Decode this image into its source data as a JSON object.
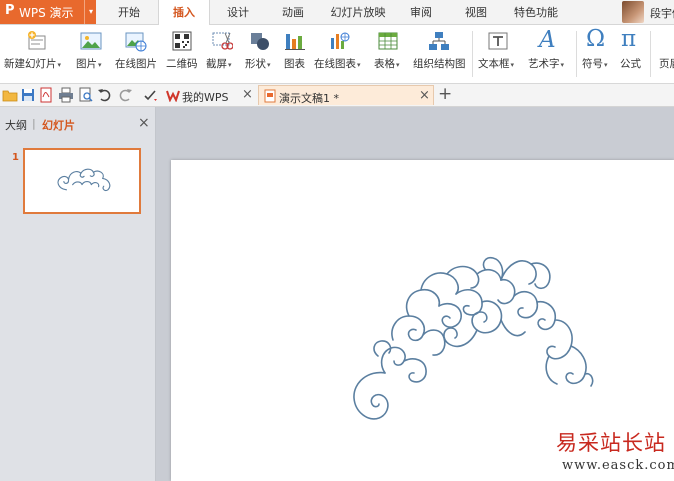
{
  "app": {
    "logo_glyph": "P",
    "title": "WPS 演示",
    "menu_arrow": "▾",
    "accent_color": "#e8692d"
  },
  "menu": {
    "tabs": [
      {
        "label": "开始"
      },
      {
        "label": "插入",
        "active": true
      },
      {
        "label": "设计"
      },
      {
        "label": "动画"
      },
      {
        "label": "幻灯片放映"
      },
      {
        "label": "审阅"
      },
      {
        "label": "视图"
      },
      {
        "label": "特色功能"
      }
    ],
    "user_name": "段宇倩"
  },
  "ribbon": {
    "buttons": [
      {
        "label": "新建幻灯片",
        "icon": "new-slide-icon",
        "dropdown": true
      },
      {
        "label": "图片",
        "icon": "picture-icon",
        "dropdown": true
      },
      {
        "label": "在线图片",
        "icon": "online-picture-icon",
        "dropdown": false
      },
      {
        "label": "二维码",
        "icon": "qrcode-icon",
        "dropdown": false
      },
      {
        "label": "截屏",
        "icon": "screenshot-icon",
        "dropdown": true
      },
      {
        "label": "形状",
        "icon": "shapes-icon",
        "dropdown": true
      },
      {
        "label": "图表",
        "icon": "chart-icon",
        "dropdown": false
      },
      {
        "label": "在线图表",
        "icon": "online-chart-icon",
        "dropdown": true
      },
      {
        "label": "表格",
        "icon": "table-icon",
        "dropdown": true
      },
      {
        "label": "组织结构图",
        "icon": "org-chart-icon",
        "dropdown": false
      },
      {
        "label": "文本框",
        "icon": "textbox-icon",
        "dropdown": true
      },
      {
        "label": "艺术字",
        "icon": "wordart-icon",
        "dropdown": true
      },
      {
        "label": "符号",
        "icon": "symbol-icon",
        "dropdown": true
      },
      {
        "label": "公式",
        "icon": "formula-icon",
        "dropdown": false
      },
      {
        "label": "页眉",
        "icon": "header-icon",
        "dropdown": false
      }
    ],
    "dropdown_glyph": "▾",
    "wordart_glyph": "A",
    "symbol_glyph": "Ω",
    "formula_glyph": "π"
  },
  "quick_access": {
    "items": [
      "open-icon",
      "save-icon",
      "export-pdf-icon",
      "print-icon",
      "print-preview-icon",
      "undo-icon",
      "redo-icon",
      "customize-icon"
    ]
  },
  "doc_tabs": {
    "tabs": [
      {
        "label": "我的WPS",
        "close": "×"
      },
      {
        "label": "演示文稿1 *",
        "close": "×",
        "active": true
      }
    ],
    "new_tab": "+"
  },
  "left_panel": {
    "tab_outline": "大纲",
    "divider": "|",
    "tab_slides": "幻灯片",
    "close": "×",
    "slide_number": "1"
  },
  "watermark": {
    "text": "易采站长站",
    "url": "www.easck.com"
  },
  "colors": {
    "accent": "#e8692d",
    "active_tab_text": "#d4561e",
    "doodle_stroke": "#5b7fa0"
  }
}
